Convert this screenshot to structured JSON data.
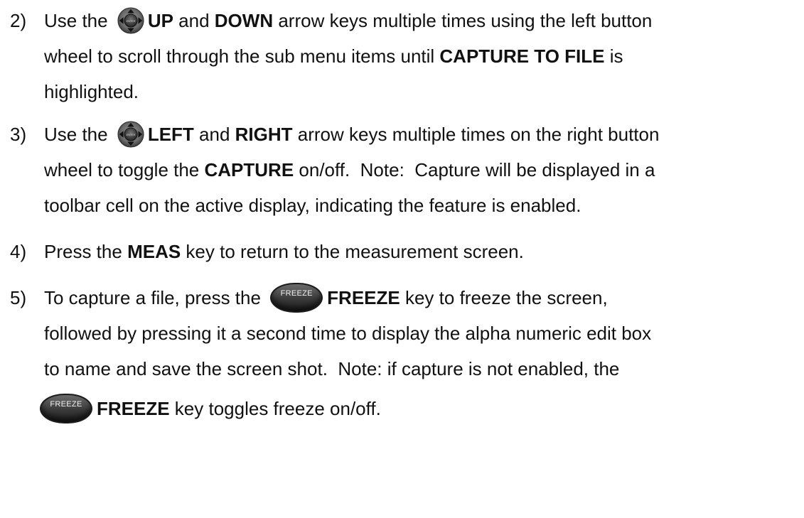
{
  "steps": [
    {
      "number": "2)",
      "lines": [
        {
          "t1": "Use the ",
          "icon": "enter-wheel-icon",
          "b1": "UP",
          "t2": " and ",
          "b2": "DOWN",
          "t3": " arrow keys multiple times using the left button"
        },
        {
          "t1": "wheel to scroll through the sub menu items until ",
          "b1": "CAPTURE TO FILE",
          "t2": " is"
        },
        {
          "t1": "highlighted."
        }
      ]
    },
    {
      "number": "3)",
      "lines": [
        {
          "t1": "Use the ",
          "icon": "enter-wheel-icon",
          "b1": "LEFT",
          "t2": " and ",
          "b2": "RIGHT",
          "t3": " arrow keys multiple times on the right button"
        },
        {
          "t1": "wheel to toggle the ",
          "b1": "CAPTURE",
          "t2": " on/off.  Note:  Capture will be displayed in a"
        },
        {
          "t1": "toolbar cell on the active display, indicating the feature is enabled."
        }
      ]
    },
    {
      "number": "4)",
      "lines": [
        {
          "t1": "Press the ",
          "b1": "MEAS",
          "t2": " key to return to the measurement screen."
        }
      ]
    },
    {
      "number": "5)",
      "lines": [
        {
          "t1": "To capture a file, press the ",
          "key": "FREEZE",
          "b1": "FREEZE",
          "t2": " key to freeze the screen,"
        },
        {
          "t1": "followed by pressing it a second time to display the alpha numeric edit box"
        },
        {
          "t1": "to name and save the screen shot.  Note: if capture is not enabled, the"
        },
        {
          "key": "FREEZE",
          "b1": "FREEZE",
          "t2": " key toggles freeze on/off."
        }
      ]
    }
  ],
  "icons": {
    "wheel_inner_label": "ENTER"
  }
}
